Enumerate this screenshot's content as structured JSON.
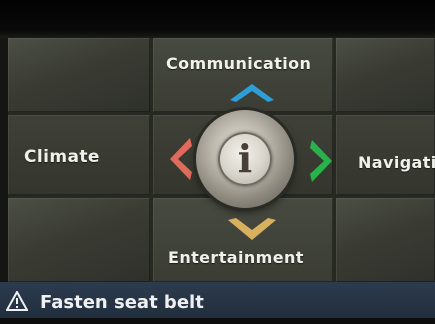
{
  "menu": {
    "top_label": "Communication",
    "left_label": "Climate",
    "right_label": "Navigati",
    "bottom_label": "Entertainment",
    "center_glyph": "i"
  },
  "arrows": {
    "up_color": "#2e9fd6",
    "down_color": "#d8b15f",
    "left_color": "#e06b5c",
    "right_color": "#27b34a"
  },
  "icons": {
    "up": "chevron-up-icon",
    "down": "chevron-down-icon",
    "left": "chevron-left-icon",
    "right": "chevron-right-icon",
    "center": "info-icon",
    "status": "warning-icon"
  },
  "status": {
    "message": "Fasten seat belt"
  }
}
